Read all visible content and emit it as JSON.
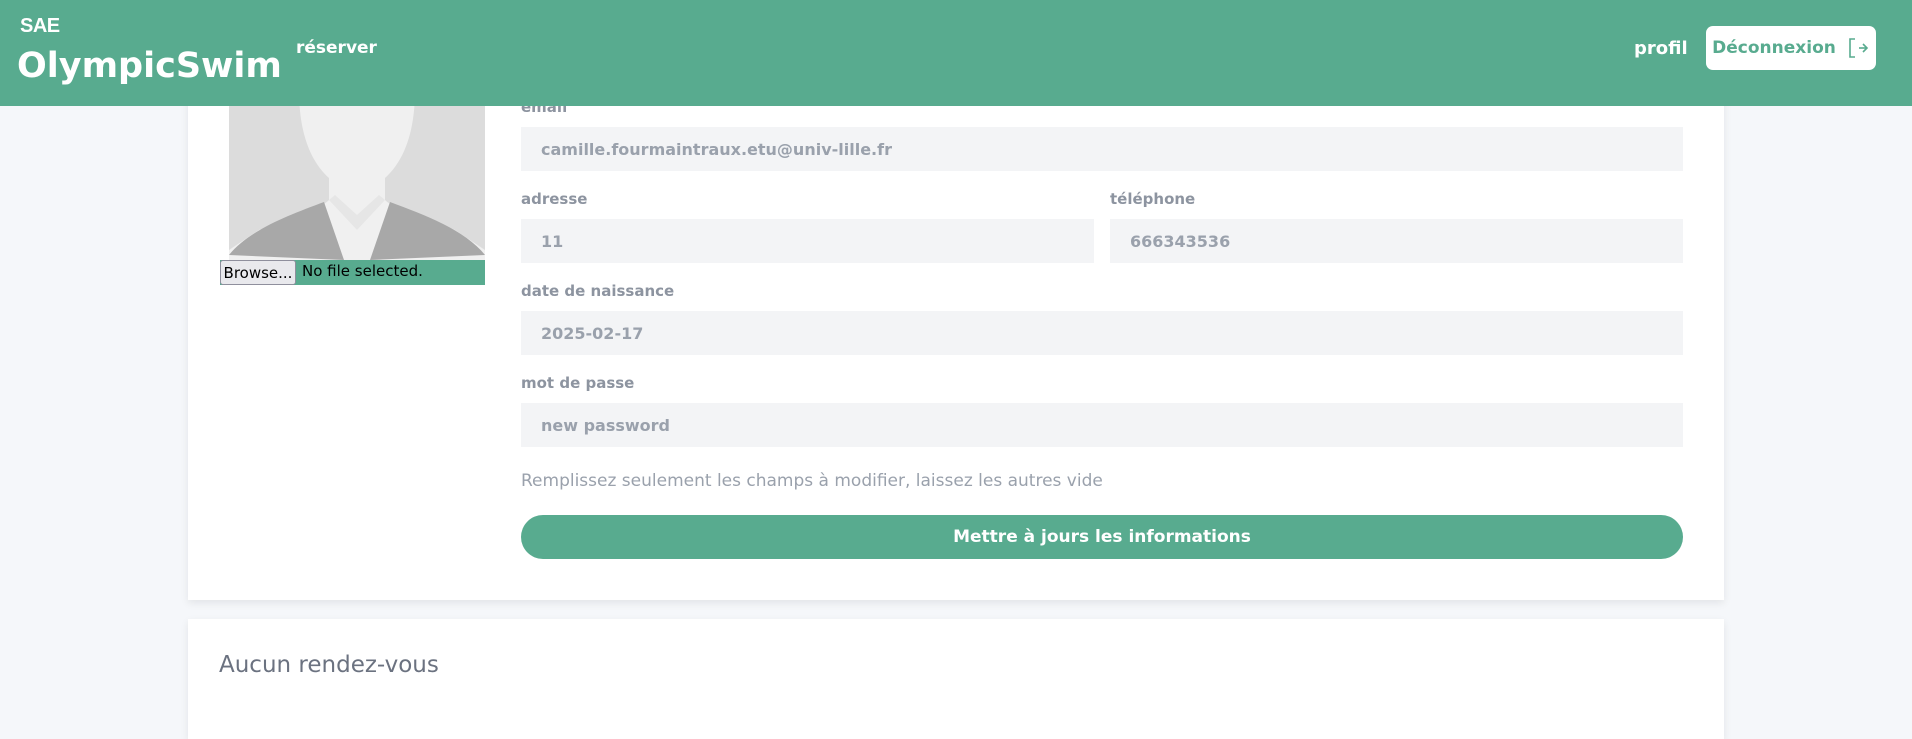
{
  "header": {
    "brand_small": "SAE",
    "brand_main": "OlympicSwim",
    "nav_reserver": "réserver",
    "nav_profil": "profil",
    "logout_label": "Déconnexion"
  },
  "avatar": {
    "browse_label": "Browse...",
    "file_status": "No file selected."
  },
  "form": {
    "email_label": "email",
    "email_value": "camille.fourmaintraux.etu@univ-lille.fr",
    "adresse_label": "adresse",
    "adresse_value": "11",
    "telephone_label": "téléphone",
    "telephone_value": "666343536",
    "naissance_label": "date de naissance",
    "naissance_value": "2025-02-17",
    "password_label": "mot de passe",
    "password_placeholder": "new password",
    "hint": "Remplissez seulement les champs à modifier, laissez les autres vide",
    "submit_label": "Mettre à jours les informations"
  },
  "appointments": {
    "empty_title": "Aucun rendez-vous"
  },
  "colors": {
    "accent": "#58ab8f",
    "field_bg": "#f3f4f6",
    "muted_text": "#9aa1ac"
  }
}
